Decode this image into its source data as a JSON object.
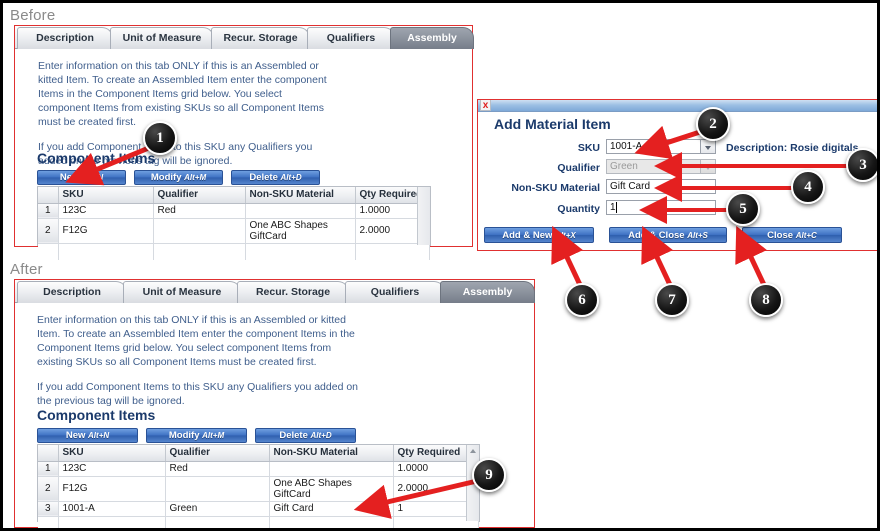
{
  "captions": {
    "before": "Before",
    "after": "After"
  },
  "tabs": [
    {
      "label": "Description",
      "active": false
    },
    {
      "label": "Unit of Measure",
      "active": false
    },
    {
      "label": "Recur. Storage",
      "active": false
    },
    {
      "label": "Qualifiers",
      "active": false
    },
    {
      "label": "Assembly",
      "active": true
    }
  ],
  "before": {
    "paragraph1": "Enter information on this tab ONLY if this is an Assembled or kitted Item. To create an Assembled Item enter the component Items in the Component Items grid below. You select component Items from existing SKUs so all Component Items must be created first.",
    "paragraph2": "If you add Component Items to this SKU any Qualifiers you added on the previous tag will be ignored.",
    "section_heading": "Component Items",
    "buttons": [
      {
        "label": "New",
        "accel": "Alt+N"
      },
      {
        "label": "Modify",
        "accel": "Alt+M"
      },
      {
        "label": "Delete",
        "accel": "Alt+D"
      }
    ],
    "grid": {
      "columns": [
        "",
        "SKU",
        "Qualifier",
        "Non-SKU Material",
        "Qty Required"
      ],
      "rows": [
        {
          "n": "1",
          "sku": "123C",
          "qualifier": "Red",
          "material": "",
          "qty": "1.0000"
        },
        {
          "n": "2",
          "sku": "F12G",
          "qualifier": "",
          "material": "One ABC Shapes GiftCard",
          "qty": "2.0000"
        }
      ]
    }
  },
  "after": {
    "paragraph1": "Enter information on this tab ONLY if this is an Assembled or kitted Item. To create an Assembled Item enter the component Items in the Component Items grid below. You select component Items from existing SKUs so all Component Items must be created first.",
    "paragraph2": "If you add Component Items to this SKU any Qualifiers you added on the previous tag will be ignored.",
    "section_heading": "Component Items",
    "buttons": [
      {
        "label": "New",
        "accel": "Alt+N"
      },
      {
        "label": "Modify",
        "accel": "Alt+M"
      },
      {
        "label": "Delete",
        "accel": "Alt+D"
      }
    ],
    "grid": {
      "columns": [
        "",
        "SKU",
        "Qualifier",
        "Non-SKU Material",
        "Qty Required"
      ],
      "rows": [
        {
          "n": "1",
          "sku": "123C",
          "qualifier": "Red",
          "material": "",
          "qty": "1.0000"
        },
        {
          "n": "2",
          "sku": "F12G",
          "qualifier": "",
          "material": "One ABC Shapes GiftCard",
          "qty": "2.0000"
        },
        {
          "n": "3",
          "sku": "1001-A",
          "qualifier": "Green",
          "material": "Gift Card",
          "qty": "1"
        }
      ]
    }
  },
  "dialog": {
    "close_glyph": "x",
    "title": "Add Material Item",
    "fields": {
      "sku_label": "SKU",
      "sku_value": "1001-A",
      "qualifier_label": "Qualifier",
      "qualifier_value": "Green",
      "material_label": "Non-SKU Material",
      "material_value": "Gift Card",
      "quantity_label": "Quantity",
      "quantity_value": "1"
    },
    "description": "Description: Rosie digitals",
    "buttons": [
      {
        "label": "Add & New",
        "accel": "Alt+X"
      },
      {
        "label": "Add & Close",
        "accel": "Alt+S"
      },
      {
        "label": "Close",
        "accel": "Alt+C"
      }
    ]
  },
  "callouts": [
    {
      "n": "1"
    },
    {
      "n": "2"
    },
    {
      "n": "3"
    },
    {
      "n": "4"
    },
    {
      "n": "5"
    },
    {
      "n": "6"
    },
    {
      "n": "7"
    },
    {
      "n": "8"
    },
    {
      "n": "9"
    }
  ],
  "colors": {
    "annotation_red": "#e42020",
    "panel_border": "#e03030",
    "text_blue": "#3f5e8c",
    "heading_blue": "#1b3a6b",
    "button_blue": "#3f72c4"
  }
}
